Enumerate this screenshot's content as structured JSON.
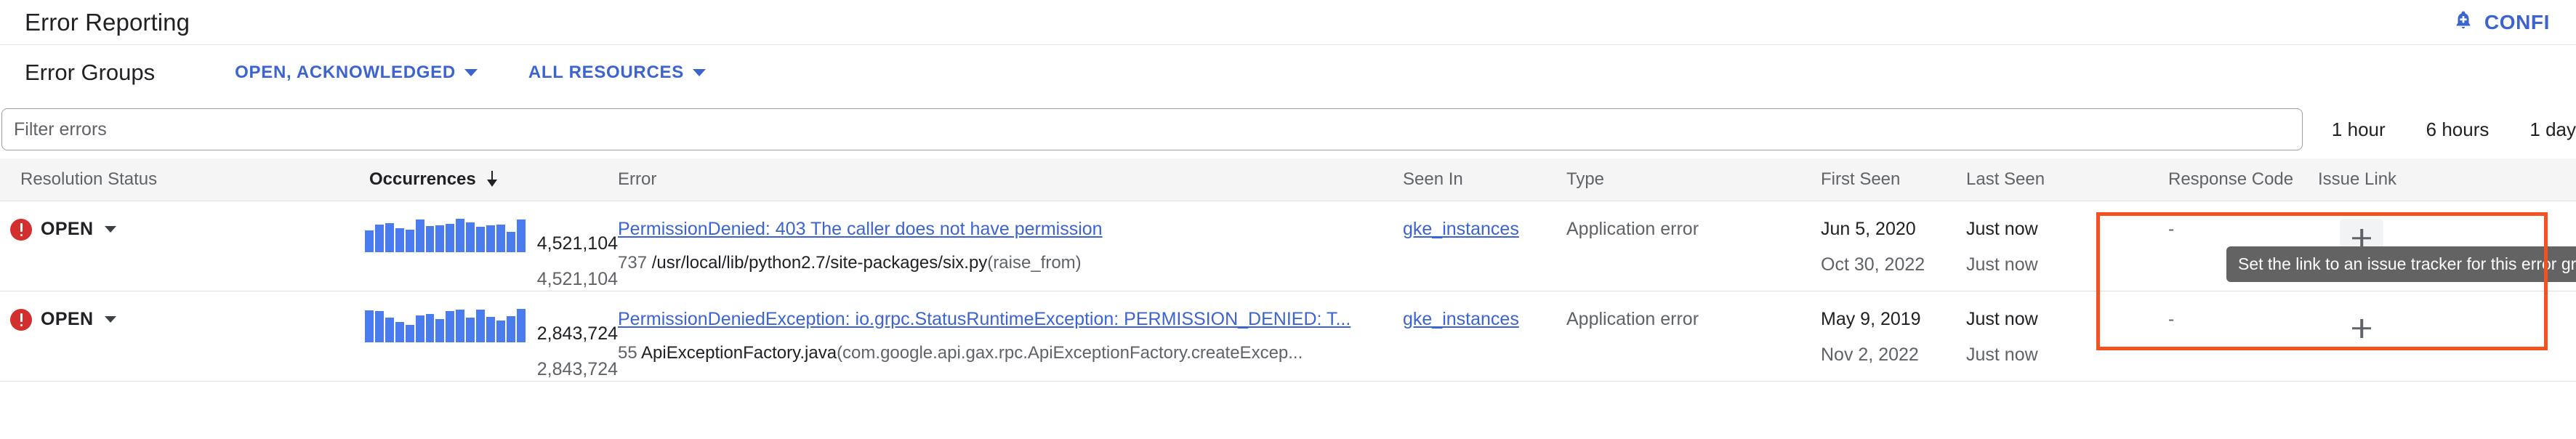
{
  "appbar": {
    "title": "Error Reporting",
    "bell_icon": "notifications-add-icon",
    "configure_label": "CONFI"
  },
  "subheader": {
    "section_title": "Error Groups",
    "status_filter": {
      "label": "OPEN, ACKNOWLEDGED",
      "caret_icon": "chevron-down-icon"
    },
    "resource_filter": {
      "label": "ALL RESOURCES",
      "caret_icon": "chevron-down-icon"
    }
  },
  "filter": {
    "placeholder": "Filter errors",
    "value": "",
    "time_ranges": [
      "1 hour",
      "6 hours",
      "1 day"
    ]
  },
  "table": {
    "headers": {
      "resolution_status": "Resolution Status",
      "occurrences": "Occurrences",
      "sort_icon": "sort-descending-arrow-icon",
      "error": "Error",
      "seen_in": "Seen In",
      "type": "Type",
      "first_seen": "First Seen",
      "last_seen": "Last Seen",
      "response_code": "Response Code",
      "issue_link": "Issue Link"
    },
    "rows": [
      {
        "status_icon": "error-circle-icon",
        "status": "OPEN",
        "status_caret": "chevron-down-icon",
        "sparkline": [
          64,
          82,
          86,
          70,
          66,
          96,
          78,
          80,
          84,
          100,
          88,
          76,
          80,
          82,
          60,
          96
        ],
        "occurrences_primary": "4,521,104",
        "occurrences_secondary": "4,521,104",
        "error_title": "PermissionDenied: 403 The caller does not have permission",
        "error_line": "737",
        "error_file": "/usr/local/lib/python2.7/site-packages/six.py",
        "error_function": "(raise_from)",
        "seen_in": "gke_instances",
        "type": "Application error",
        "first_seen_primary": "Jun 5, 2020",
        "first_seen_secondary": "Oct 30, 2022",
        "last_seen_primary": "Just now",
        "last_seen_secondary": "Just now",
        "response_code": "-",
        "issue_link_icon": "plus-icon",
        "tooltip": "Set the link to an issue tracker for this error group"
      },
      {
        "status_icon": "error-circle-icon",
        "status": "OPEN",
        "status_caret": "chevron-down-icon",
        "sparkline": [
          90,
          88,
          70,
          58,
          50,
          76,
          80,
          66,
          88,
          92,
          70,
          92,
          72,
          62,
          74,
          96
        ],
        "occurrences_primary": "2,843,724",
        "occurrences_secondary": "2,843,724",
        "error_title": "PermissionDeniedException: io.grpc.StatusRuntimeException: PERMISSION_DENIED: T...",
        "error_line": "55",
        "error_file": "ApiExceptionFactory.java",
        "error_function": "(com.google.api.gax.rpc.ApiExceptionFactory.createExcep...",
        "seen_in": "gke_instances",
        "type": "Application error",
        "first_seen_primary": "May 9, 2019",
        "first_seen_secondary": "Nov 2, 2022",
        "last_seen_primary": "Just now",
        "last_seen_secondary": "Just now",
        "response_code": "-",
        "issue_link_icon": "plus-icon",
        "tooltip": ""
      }
    ]
  },
  "annotation": {
    "highlight_color": "#f4511e"
  },
  "colors": {
    "link": "#3c64d0",
    "sparkline": "#4a7cf0",
    "error_red": "#d32f2f",
    "header_bg": "#f5f5f5"
  }
}
